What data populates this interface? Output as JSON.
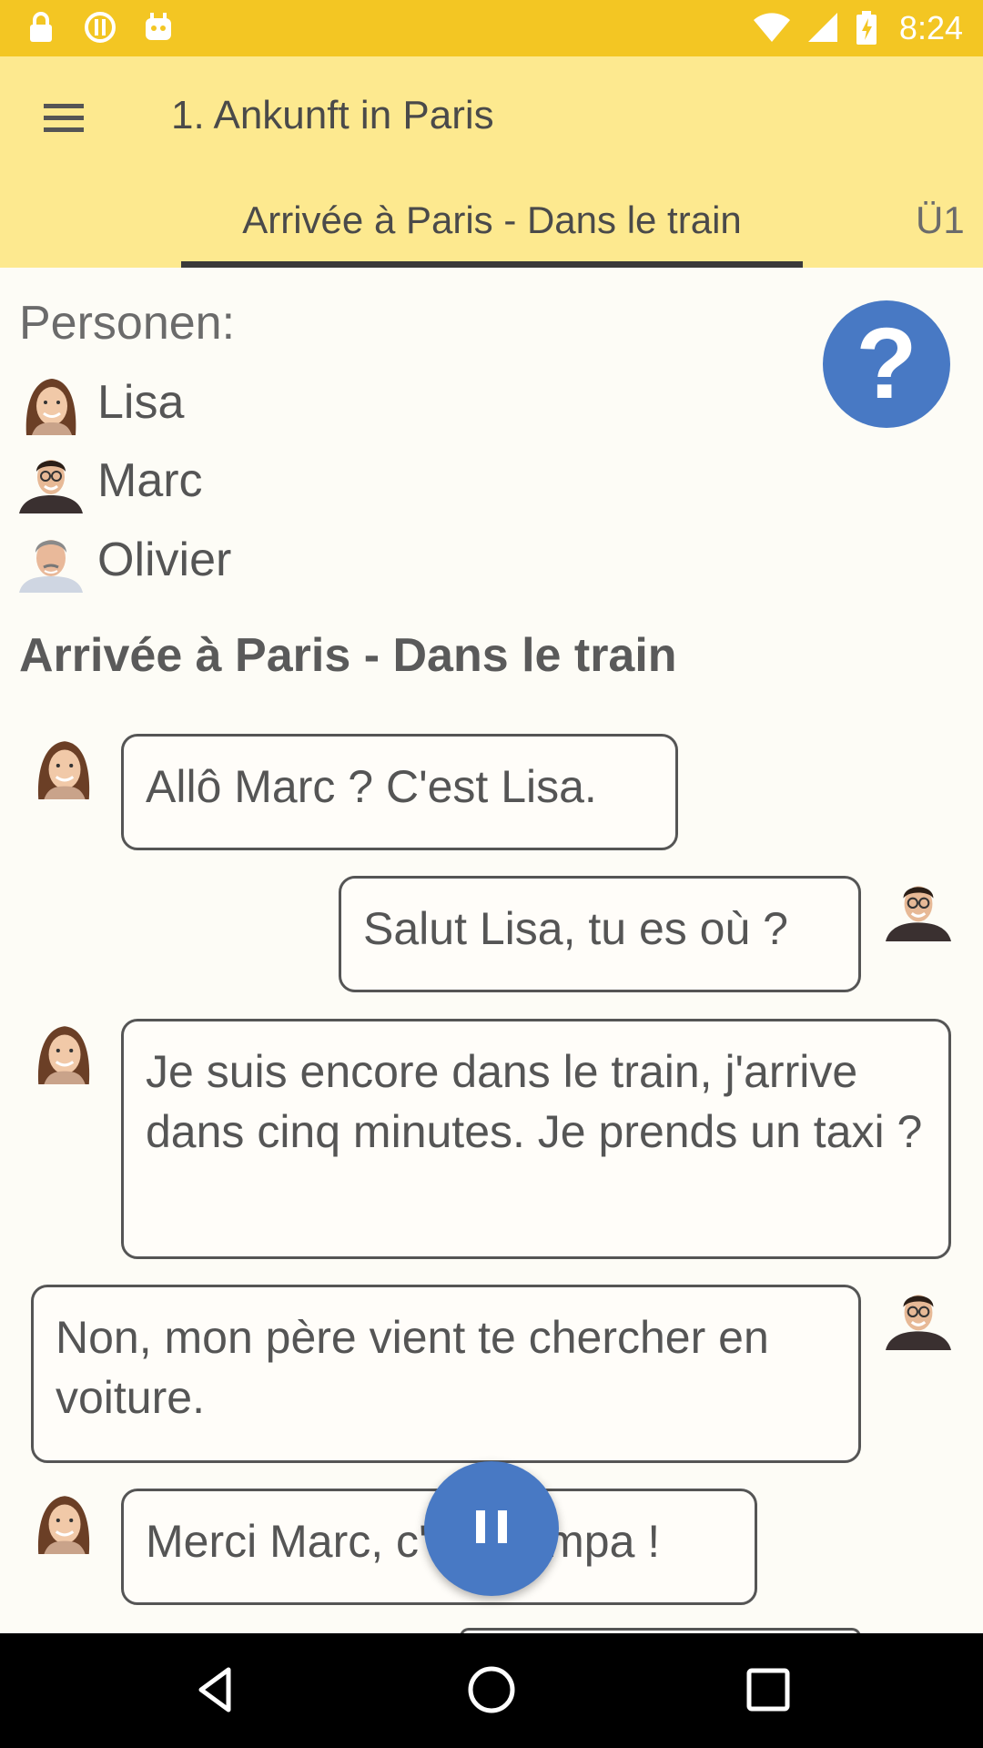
{
  "status_bar": {
    "time": "8:24",
    "icons": [
      "lock-icon",
      "alert-icon",
      "android-icon",
      "wifi-icon",
      "signal-icon",
      "battery-icon"
    ]
  },
  "app_bar": {
    "title": "1. Ankunft in Paris",
    "tabs": [
      {
        "label": "Arrivée à Paris - Dans le train",
        "active": true
      },
      {
        "label": "Ü1",
        "active": false
      }
    ]
  },
  "people": {
    "heading": "Personen:",
    "list": [
      {
        "name": "Lisa"
      },
      {
        "name": "Marc"
      },
      {
        "name": "Olivier"
      }
    ]
  },
  "section_title": "Arrivée à Paris - Dans le train",
  "dialogue": [
    {
      "speaker": "Lisa",
      "text": "Allô Marc ? C'est Lisa."
    },
    {
      "speaker": "Marc",
      "text": "Salut Lisa, tu es où ?"
    },
    {
      "speaker": "Lisa",
      "text": "Je suis encore dans le train, j'arrive dans cinq minutes. Je prends un taxi ?"
    },
    {
      "speaker": "Marc",
      "text": "Non, mon père vient te chercher en voiture."
    },
    {
      "speaker": "Lisa",
      "text": "Merci Marc, c'est sympa !"
    }
  ],
  "colors": {
    "status_bar": "#f3c623",
    "app_bar": "#fde98f",
    "accent_blue": "#4879c4",
    "background": "#fdfcf6"
  },
  "icons": {
    "menu": "menu-icon",
    "help": "question-mark-icon",
    "pause": "pause-icon",
    "nav": [
      "back-icon",
      "home-icon",
      "recents-icon"
    ]
  }
}
